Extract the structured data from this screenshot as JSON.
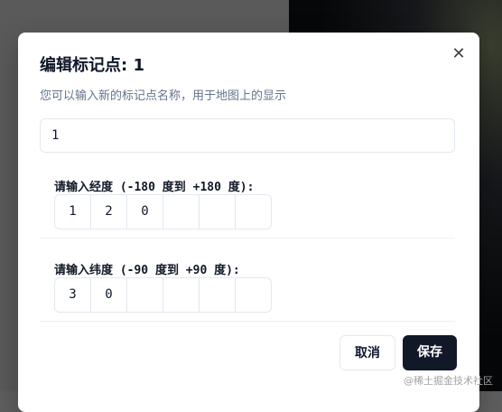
{
  "dialog": {
    "title": "编辑标记点: 1",
    "subtitle": "您可以输入新的标记点名称，用于地图上的显示",
    "close_icon": "close-icon",
    "name_input_value": "1",
    "longitude": {
      "label": "请输入经度 (-180 度到 +180 度):",
      "digits": [
        "1",
        "2",
        "0",
        "",
        "",
        ""
      ]
    },
    "latitude": {
      "label": "请输入纬度 (-90 度到 +90 度):",
      "digits": [
        "3",
        "0",
        "",
        "",
        "",
        ""
      ]
    },
    "cancel_label": "取消",
    "save_label": "保存"
  },
  "watermark": "@稀土掘金技术社区",
  "colors": {
    "primary_button": "#111827",
    "border": "#e2e8f0",
    "muted_text": "#64748b"
  }
}
